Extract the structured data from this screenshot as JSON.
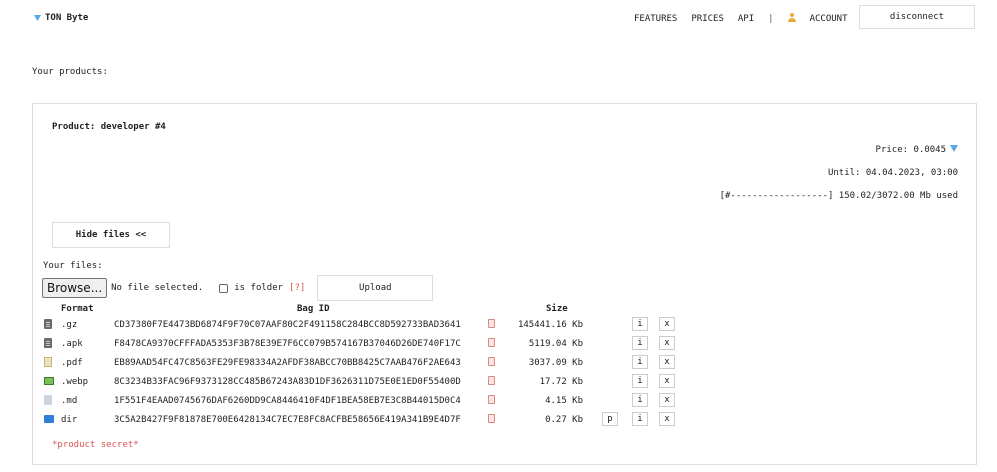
{
  "header": {
    "brand": "TON Byte",
    "nav": [
      "FEATURES",
      "PRICES",
      "API"
    ],
    "separator": "|",
    "account": "ACCOUNT",
    "disconnect": "disconnect"
  },
  "section_title": "Your products:",
  "product": {
    "title": "Product: developer #4",
    "price": "Price: 0.0045",
    "until": "Until: 04.04.2023, 03:00",
    "usage": "[#------------------] 150.02/3072.00 Mb used",
    "hide_files": "Hide files <<"
  },
  "files": {
    "label": "Your files:",
    "browse": "Browse...",
    "no_file": "No file selected.",
    "is_folder": "is folder",
    "help": "[?]",
    "upload": "Upload",
    "columns": {
      "format": "Format",
      "bag_id": "Bag ID",
      "size": "Size"
    },
    "rows": [
      {
        "icon": "file-icon",
        "format": ".gz",
        "bag_id": "CD37380F7E4473BD6874F9F70C07AAF80C2F491158C284BCC8D592733BAD3641",
        "size": "145441.16 Kb",
        "p": "",
        "i": "i",
        "x": "x"
      },
      {
        "icon": "file-icon",
        "format": ".apk",
        "bag_id": "F8478CA9370CFFFADA5353F3B78E39E7F6CC079B574167B37046D26DE740F17C",
        "size": "5119.04 Kb",
        "p": "",
        "i": "i",
        "x": "x"
      },
      {
        "icon": "pdf-icon",
        "format": ".pdf",
        "bag_id": "EB89AAD54FC47C8563FE29FE98334A2AFDF38ABCC70BB8425C7AAB476F2AE643",
        "size": "3037.09 Kb",
        "p": "",
        "i": "i",
        "x": "x"
      },
      {
        "icon": "image-icon",
        "format": ".webp",
        "bag_id": "8C3234B33FAC96F9373128CC485B67243A83D1DF3626311D75E0E1ED0F55400D",
        "size": "17.72 Kb",
        "p": "",
        "i": "i",
        "x": "x"
      },
      {
        "icon": "text-file-icon",
        "format": ".md",
        "bag_id": "1F551F4EAAD0745676DAF6260DD9CA8446410F4DF1BEA58EB7E3C8B44015D0C4",
        "size": "4.15 Kb",
        "p": "",
        "i": "i",
        "x": "x"
      },
      {
        "icon": "folder-icon",
        "format": "dir",
        "bag_id": "3C5A2B427F9F81878E700E6428134C7EC7E8FC8ACFBE58656E419A341B9E4D7F",
        "size": "0.27 Kb",
        "p": "p",
        "i": "i",
        "x": "x"
      }
    ]
  },
  "secret": "*product secret*",
  "colors": {
    "accent_red": "#d9534f",
    "gem_blue": "#5aa9e6",
    "folder_blue": "#2f7ed8"
  }
}
